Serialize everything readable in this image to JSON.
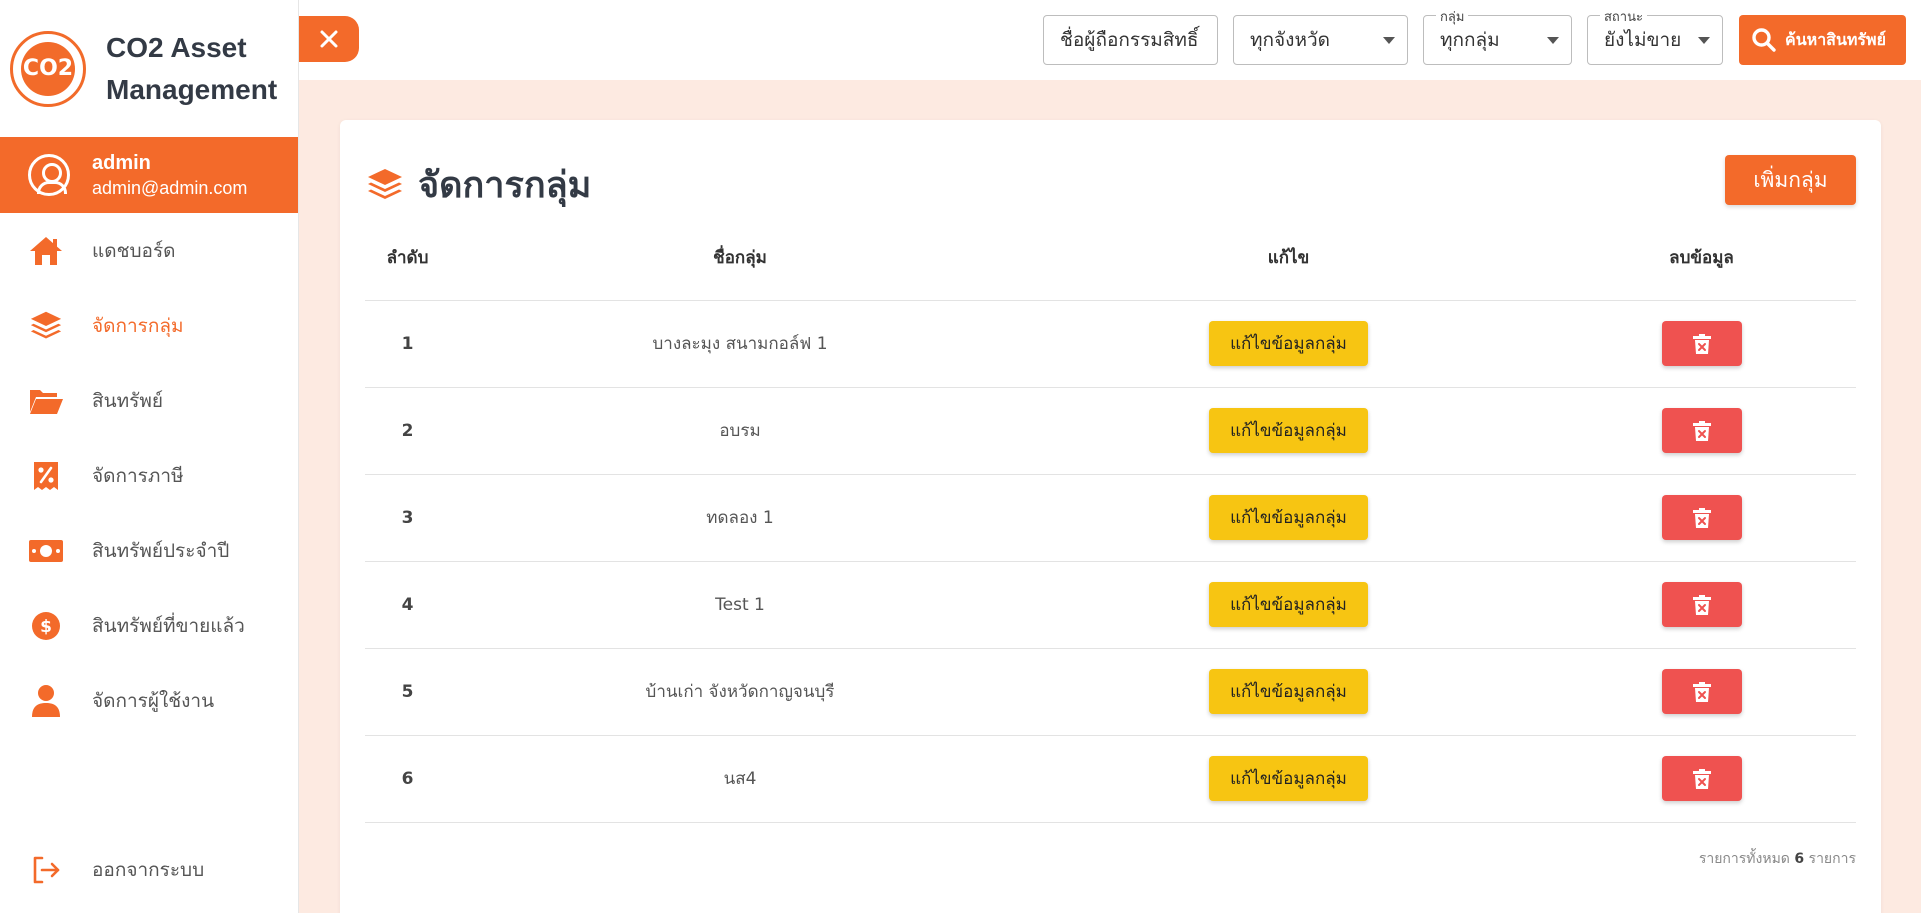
{
  "brand": {
    "logo_text": "CO2",
    "title_line1": "CO2 Asset",
    "title_line2": "Management"
  },
  "user": {
    "name": "admin",
    "email": "admin@admin.com"
  },
  "menu": [
    {
      "label": "แดชบอร์ด",
      "icon": "home-icon",
      "active": false
    },
    {
      "label": "จัดการกลุ่ม",
      "icon": "layers-icon",
      "active": true
    },
    {
      "label": "สินทรัพย์",
      "icon": "folder-open-icon",
      "active": false
    },
    {
      "label": "จัดการภาษี",
      "icon": "tax-receipt-icon",
      "active": false
    },
    {
      "label": "สินทรัพย์ประจำปี",
      "icon": "money-bill-icon",
      "active": false
    },
    {
      "label": "สินทรัพย์ที่ขายแล้ว",
      "icon": "dollar-coin-icon",
      "active": false
    },
    {
      "label": "จัดการผู้ใช้งาน",
      "icon": "user-icon",
      "active": false
    }
  ],
  "logout_label": "ออกจากระบบ",
  "topbar": {
    "owner_placeholder": "ชื่อผู้ถือกรรมสิทธิ์",
    "province_value": "ทุกจังหวัด",
    "group_label": "กลุ่ม",
    "group_value": "ทุกกลุ่ม",
    "status_label": "สถานะ",
    "status_value": "ยังไม่ขาย",
    "search_label": "ค้นหาสินทรัพย์"
  },
  "page": {
    "title": "จัดการกลุ่ม",
    "add_button": "เพิ่มกลุ่ม",
    "columns": {
      "order": "ลำดับ",
      "name": "ชื่อกลุ่ม",
      "edit": "แก้ไข",
      "delete": "ลบข้อมูล"
    },
    "edit_label": "แก้ไขข้อมูลกลุ่ม",
    "rows": [
      {
        "no": "1",
        "name": "บางละมุง สนามกอล์ฟ 1"
      },
      {
        "no": "2",
        "name": "อบรม"
      },
      {
        "no": "3",
        "name": "ทดลอง 1"
      },
      {
        "no": "4",
        "name": "Test 1"
      },
      {
        "no": "5",
        "name": "บ้านเก่า จังหวัดกาญจนบุรี"
      },
      {
        "no": "6",
        "name": "นส4"
      }
    ],
    "total_prefix": "รายการทั้งหมด",
    "total_count": "6",
    "total_suffix": "รายการ"
  },
  "colors": {
    "accent": "#f36a2a",
    "edit": "#f7c512",
    "delete": "#ef5250"
  }
}
